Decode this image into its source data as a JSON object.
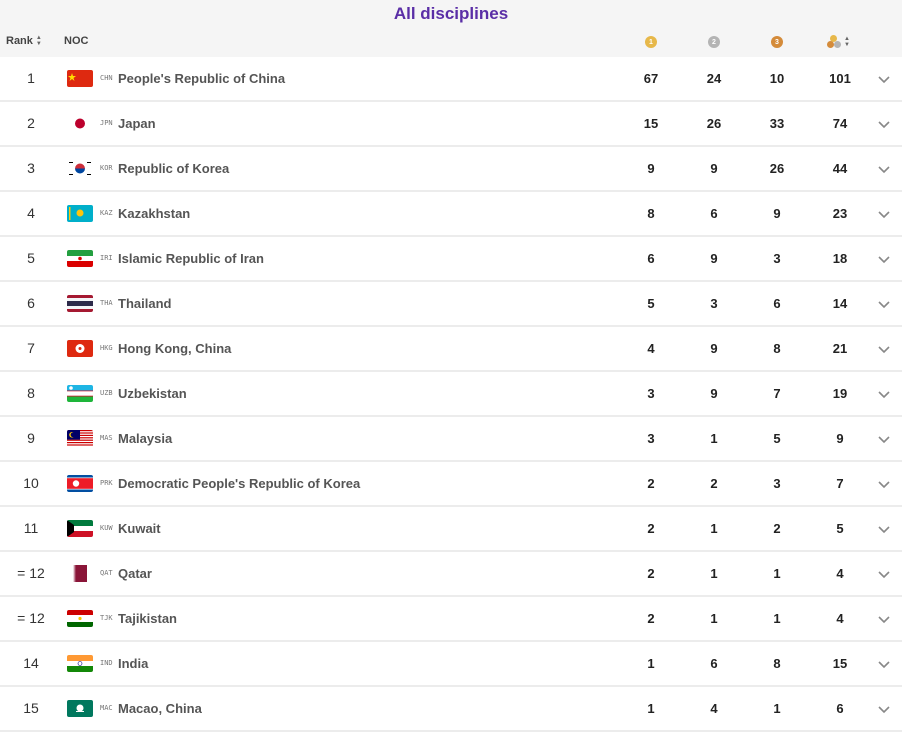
{
  "title": "All disciplines",
  "header": {
    "rank": "Rank",
    "noc": "NOC"
  },
  "rows": [
    {
      "rank": "1",
      "code": "CHN",
      "name": "People's Republic of China",
      "gold": "67",
      "silver": "24",
      "bronze": "10",
      "total": "101"
    },
    {
      "rank": "2",
      "code": "JPN",
      "name": "Japan",
      "gold": "15",
      "silver": "26",
      "bronze": "33",
      "total": "74"
    },
    {
      "rank": "3",
      "code": "KOR",
      "name": "Republic of Korea",
      "gold": "9",
      "silver": "9",
      "bronze": "26",
      "total": "44"
    },
    {
      "rank": "4",
      "code": "KAZ",
      "name": "Kazakhstan",
      "gold": "8",
      "silver": "6",
      "bronze": "9",
      "total": "23"
    },
    {
      "rank": "5",
      "code": "IRI",
      "name": "Islamic Republic of Iran",
      "gold": "6",
      "silver": "9",
      "bronze": "3",
      "total": "18"
    },
    {
      "rank": "6",
      "code": "THA",
      "name": "Thailand",
      "gold": "5",
      "silver": "3",
      "bronze": "6",
      "total": "14"
    },
    {
      "rank": "7",
      "code": "HKG",
      "name": "Hong Kong, China",
      "gold": "4",
      "silver": "9",
      "bronze": "8",
      "total": "21"
    },
    {
      "rank": "8",
      "code": "UZB",
      "name": "Uzbekistan",
      "gold": "3",
      "silver": "9",
      "bronze": "7",
      "total": "19"
    },
    {
      "rank": "9",
      "code": "MAS",
      "name": "Malaysia",
      "gold": "3",
      "silver": "1",
      "bronze": "5",
      "total": "9"
    },
    {
      "rank": "10",
      "code": "PRK",
      "name": "Democratic People's Republic of Korea",
      "gold": "2",
      "silver": "2",
      "bronze": "3",
      "total": "7"
    },
    {
      "rank": "11",
      "code": "KUW",
      "name": "Kuwait",
      "gold": "2",
      "silver": "1",
      "bronze": "2",
      "total": "5"
    },
    {
      "rank": "= 12",
      "code": "QAT",
      "name": "Qatar",
      "gold": "2",
      "silver": "1",
      "bronze": "1",
      "total": "4"
    },
    {
      "rank": "= 12",
      "code": "TJK",
      "name": "Tajikistan",
      "gold": "2",
      "silver": "1",
      "bronze": "1",
      "total": "4"
    },
    {
      "rank": "14",
      "code": "IND",
      "name": "India",
      "gold": "1",
      "silver": "6",
      "bronze": "8",
      "total": "15"
    },
    {
      "rank": "15",
      "code": "MAC",
      "name": "Macao, China",
      "gold": "1",
      "silver": "4",
      "bronze": "1",
      "total": "6"
    }
  ],
  "icons": {
    "gold": "gold-medal-icon",
    "silver": "silver-medal-icon",
    "bronze": "bronze-medal-icon",
    "total": "all-medals-icon",
    "sort": "sort-icon",
    "expand": "chevron-down-icon"
  },
  "colors": {
    "title": "#5a2ea6",
    "gold": "#e7b84a",
    "silver": "#b4b4b4",
    "bronze": "#d48b3a"
  }
}
